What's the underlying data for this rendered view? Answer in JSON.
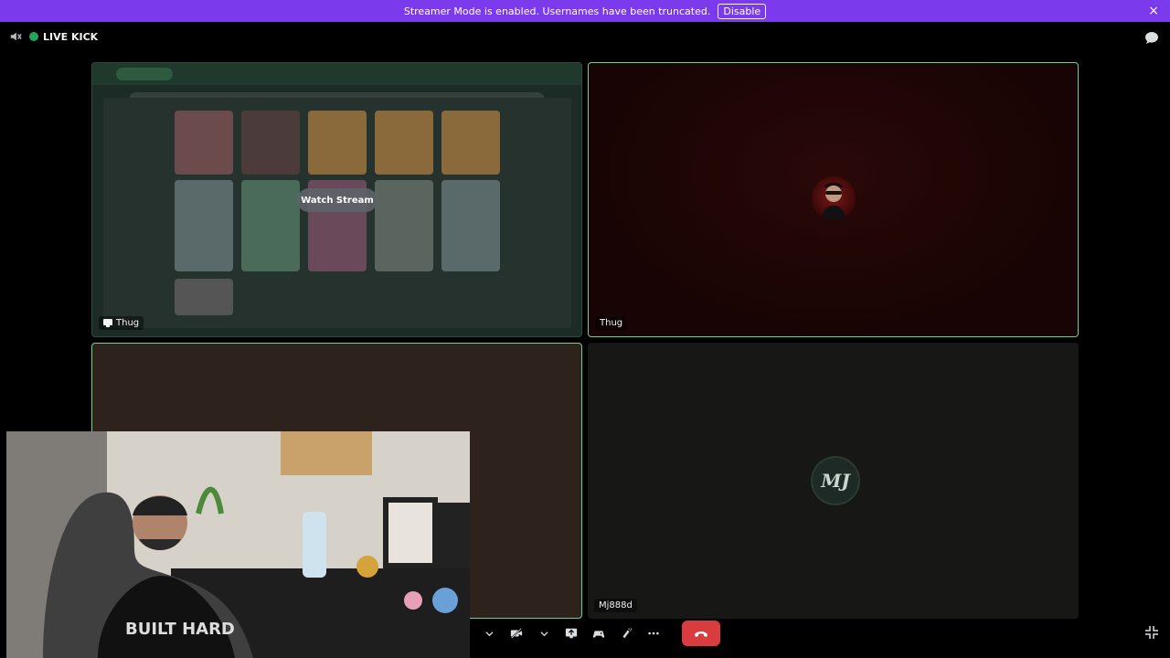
{
  "banner": {
    "message": "Streamer Mode is enabled. Usernames have been truncated.",
    "disable_label": "Disable",
    "close_icon": "×"
  },
  "channel": {
    "title": "LIVE KICK",
    "status_color": "#23a55a"
  },
  "tiles": [
    {
      "name": "Thug",
      "type": "stream",
      "watch_label": "Watch Stream"
    },
    {
      "name": "Thug",
      "type": "camera-avatar"
    },
    {
      "name": "",
      "type": "camera"
    },
    {
      "name": "Mj888d",
      "type": "avatar",
      "avatar_text": "MJ"
    }
  ],
  "controls": {
    "items": [
      "chevron-down-icon",
      "video-off-icon",
      "chevron-down-icon",
      "share-screen-icon",
      "activity-icon",
      "soundboard-icon",
      "more-icon",
      "hang-up-icon"
    ]
  },
  "colors": {
    "banner": "#7c3aed",
    "speaking_border": "#6fd28a",
    "hangup": "#d83c3e"
  }
}
